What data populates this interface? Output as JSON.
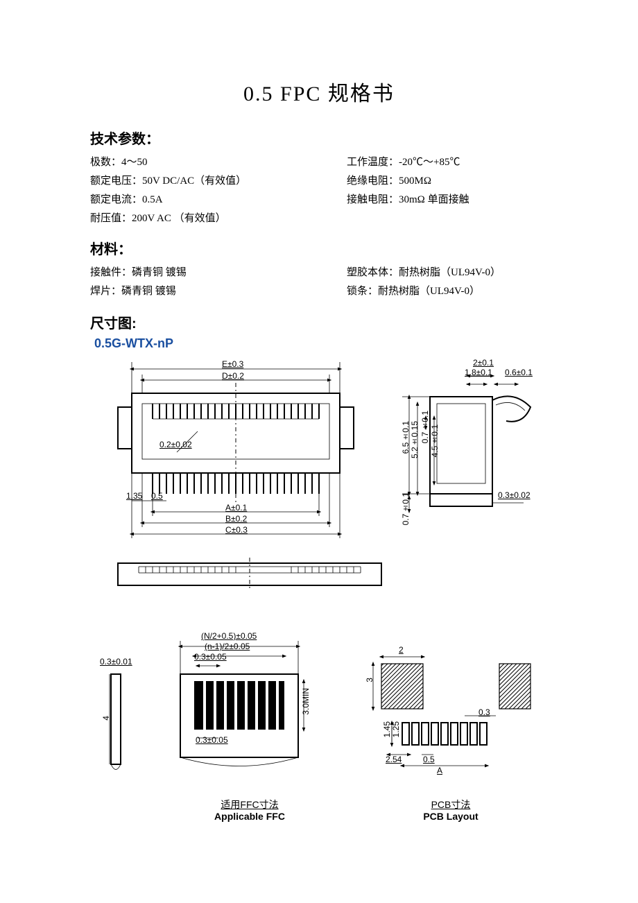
{
  "title": "0.5 FPC 规格书",
  "sections": {
    "tech": {
      "heading": "技术参数：",
      "left": [
        "极数：4～50",
        "额定电压：50V DC/AC（有效值）",
        "额定电流：0.5A",
        "耐压值：200V AC （有效值）"
      ],
      "right": [
        "",
        "工作温度：-20℃～+85℃",
        "绝缘电阻：500MΩ",
        "接触电阻：30mΩ  单面接触"
      ]
    },
    "material": {
      "heading": "材料：",
      "left": [
        "接触件：磷青铜 镀锡",
        "焊片：磷青铜 镀锡"
      ],
      "right": [
        "塑胶本体：耐热树脂（UL94V-0）",
        "锁条：耐热树脂（UL94V-0）"
      ]
    },
    "dims": {
      "heading": "尺寸图:"
    }
  },
  "part_no": "0.5G-WTX-nP",
  "dim_labels": {
    "E": "E±0.3",
    "D": "D±0.2",
    "t02": "0.2±0.02",
    "p135": "1.35",
    "p05": "0.5",
    "A": "A±0.1",
    "B": "B±0.2",
    "C": "C±0.3",
    "h201": "2±0.1",
    "h1801": "1.8±0.1",
    "h0601": "0.6±0.1",
    "v6501": "6.5±0.1",
    "v52015": "5.2±0.15",
    "v0701": "0.7±0.1",
    "v4501": "4.5±0.1",
    "v0701b": "0.7±0.1",
    "h03002": "0.3±0.02",
    "ffc_top1": "(N/2+0.5)±0.05",
    "ffc_top2": "(n-1)/2±0.05",
    "ffc_top3": "0.3±0.05",
    "ffc_bot": "0.3±0.05",
    "ffc_h": "3.0MIN",
    "ffc_side1": "0.3±0.01",
    "ffc_side2": "4",
    "pcb_2": "2",
    "pcb_3": "3",
    "pcb_03": "0.3",
    "pcb_145": "1.45",
    "pcb_125": "1.25",
    "pcb_254": "2.54",
    "pcb_05": "0.5",
    "pcb_A": "A"
  },
  "captions": {
    "ffc_zh": "适用FFC寸法",
    "ffc_en": "Applicable FFC",
    "pcb_zh": "PCB寸法",
    "pcb_en": "PCB Layout"
  }
}
